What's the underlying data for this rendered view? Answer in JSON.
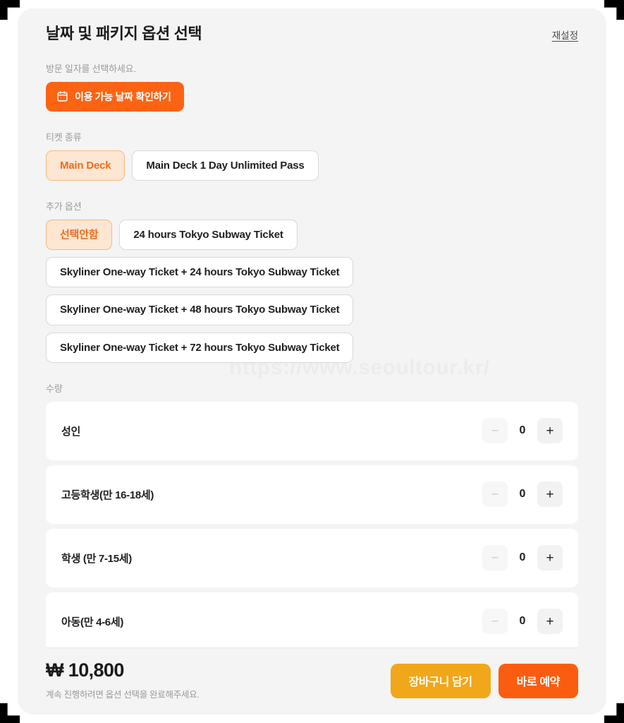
{
  "panel": {
    "title": "날짜 및 패키지 옵션 선택",
    "reset_label": "재설정",
    "watermark": "https://www.seoultour.kr/"
  },
  "date_section": {
    "label": "방문 일자를 선택하세요.",
    "button_label": "이용 가능 날짜 확인하기",
    "button_icon": "calendar-icon"
  },
  "ticket_type": {
    "label": "티켓 종류",
    "options": [
      {
        "label": "Main Deck",
        "selected": true
      },
      {
        "label": "Main Deck 1 Day Unlimited Pass",
        "selected": false
      }
    ]
  },
  "extra_option": {
    "label": "추가 옵션",
    "options": [
      {
        "label": "선택안함",
        "selected": true
      },
      {
        "label": "24 hours Tokyo Subway Ticket",
        "selected": false
      },
      {
        "label": "Skyliner One-way Ticket + 24 hours Tokyo Subway Ticket",
        "selected": false
      },
      {
        "label": "Skyliner One-way Ticket + 48 hours Tokyo Subway Ticket",
        "selected": false
      },
      {
        "label": "Skyliner One-way Ticket + 72 hours Tokyo Subway Ticket",
        "selected": false
      }
    ]
  },
  "quantity": {
    "label": "수량",
    "decrement_label": "−",
    "increment_label": "+",
    "rows": [
      {
        "label": "성인",
        "value": "0"
      },
      {
        "label": "고등학생(만 16-18세)",
        "value": "0"
      },
      {
        "label": "학생 (만 7-15세)",
        "value": "0"
      },
      {
        "label": "아동(만 4-6세)",
        "value": "0"
      }
    ]
  },
  "footer": {
    "price": "₩ 10,800",
    "note": "계속 진행하려면 옵션 선택을 완료해주세요.",
    "cart_label": "장바구니 담기",
    "reserve_label": "바로 예약"
  },
  "colors": {
    "accent_orange": "#fc6414",
    "reserve_orange": "#fb5d10",
    "cart_yellow": "#f0a719",
    "selected_chip_bg": "#fde6d2",
    "selected_chip_text": "#ef6c1d",
    "panel_bg": "#f4f4f4"
  }
}
